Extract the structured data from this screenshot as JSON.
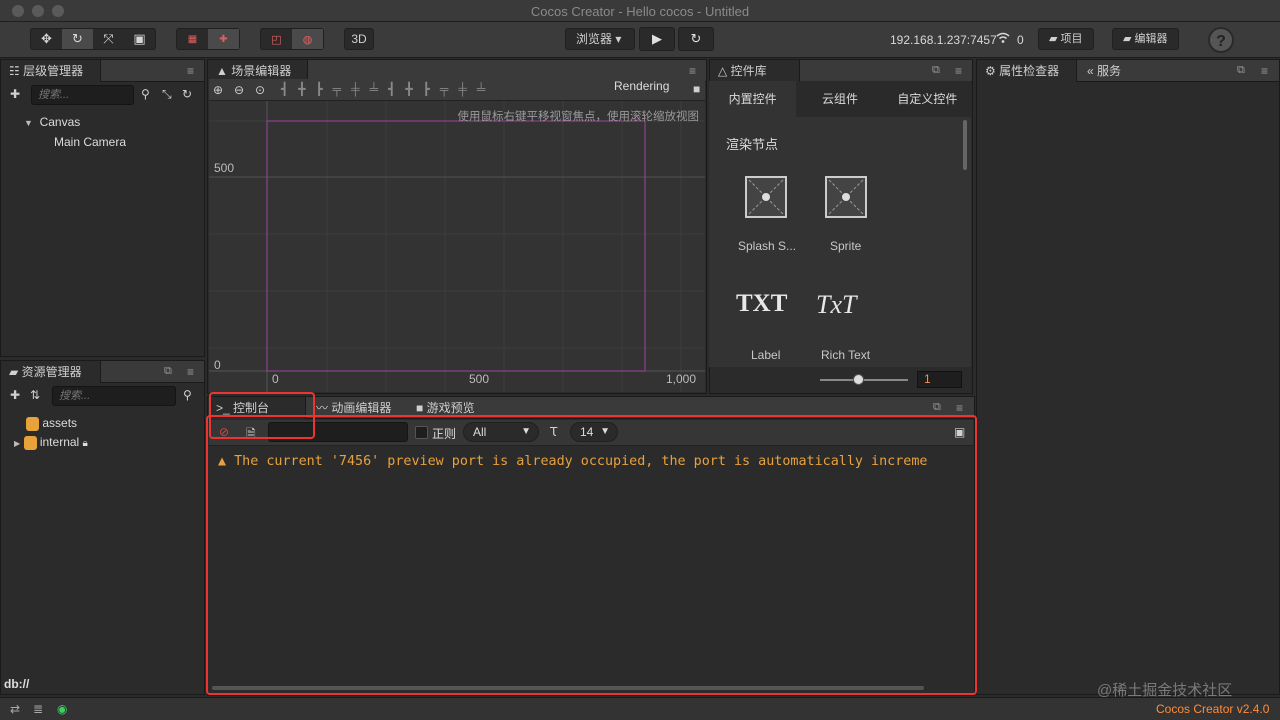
{
  "window": {
    "title": "Cocos Creator - Hello cocos - Untitled"
  },
  "toolbar": {
    "transform_tools": [
      "move-tool",
      "rotate-tool",
      "scale-tool",
      "rect-tool"
    ],
    "browser_select": "浏览器 ▾",
    "play_glyph": "▶",
    "refresh_glyph": "↻",
    "btn_3d": "3D",
    "ip_address": "192.168.1.237:7457",
    "device_count": "0",
    "project_button": "项目",
    "editor_button": "编辑器",
    "help": "?"
  },
  "hierarchy": {
    "tab": "层级管理器",
    "search_placeholder": "搜索...",
    "nodes": [
      {
        "label": "Canvas",
        "expanded": true
      },
      {
        "label": "Main Camera"
      }
    ]
  },
  "assets": {
    "tab": "资源管理器",
    "items": [
      {
        "label": "assets"
      },
      {
        "label": "internal"
      }
    ],
    "footer_path": "db://"
  },
  "scene": {
    "tab": "场景编辑器",
    "rendering_label": "Rendering",
    "hint": "使用鼠标右键平移视窗焦点，使用滚轮缩放视图",
    "y_labels": [
      "500",
      "0"
    ],
    "x_labels": [
      "0",
      "500",
      "1,000"
    ]
  },
  "widgets": {
    "tab": "控件库",
    "tabs": [
      "内置控件",
      "云组件",
      "自定义控件"
    ],
    "section": "渲染节点",
    "items": [
      {
        "label": "Splash S...",
        "icon": "splash-icon"
      },
      {
        "label": "Sprite",
        "icon": "sprite-icon"
      },
      {
        "label": "Label",
        "glyph": "TXT"
      },
      {
        "label": "Rich Text",
        "glyph": "TxT"
      }
    ],
    "zoom_value": "1"
  },
  "inspector": {
    "tab": "属性检查器",
    "service_tab": "服务"
  },
  "console": {
    "tabs": [
      "控制台",
      "动画编辑器",
      "游戏预览"
    ],
    "regex_label": "正则",
    "level_select": "All",
    "font_size": "14",
    "message": "The current '7456' preview port is already occupied, the port is automatically increme"
  },
  "status": {
    "version": "Cocos Creator v2.4.0",
    "watermark": "@稀土掘金技术社区"
  },
  "colors": {
    "warning": "#e8a13c",
    "highlight_box": "#ee3333",
    "canvas_frame": "#a040a0",
    "version": "#ff8c3a"
  }
}
